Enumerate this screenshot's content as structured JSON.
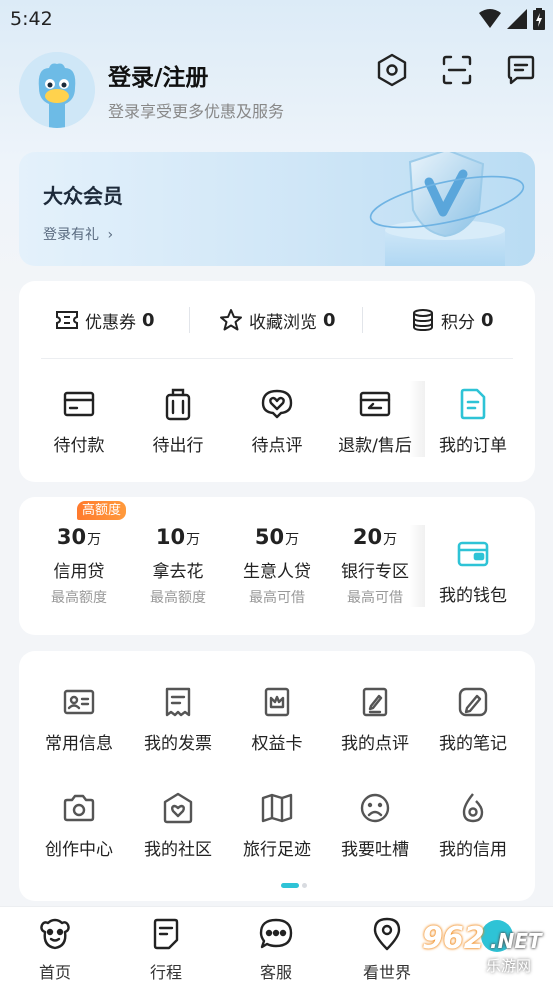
{
  "status_bar": {
    "time": "5:42"
  },
  "header": {
    "title": "登录/注册",
    "subtitle": "登录享受更多优惠及服务",
    "icons": [
      "settings-icon",
      "scan-icon",
      "message-icon"
    ]
  },
  "member_card": {
    "title": "大众会员",
    "link": "登录有礼",
    "chevron": "›"
  },
  "stats": [
    {
      "label": "优惠券",
      "value": "0",
      "icon": "coupon-icon"
    },
    {
      "label": "收藏浏览",
      "value": "0",
      "icon": "star-icon"
    },
    {
      "label": "积分",
      "value": "0",
      "icon": "coins-icon"
    }
  ],
  "orders": [
    {
      "label": "待付款",
      "icon": "card-icon"
    },
    {
      "label": "待出行",
      "icon": "luggage-icon"
    },
    {
      "label": "待点评",
      "icon": "review-heart-icon"
    },
    {
      "label": "退款/售后",
      "icon": "refund-icon"
    },
    {
      "label": "我的订单",
      "icon": "order-doc-icon"
    }
  ],
  "finance": {
    "badge": "高额度",
    "items": [
      {
        "amount": "30",
        "unit": "万",
        "name": "信用贷",
        "sub": "最高额度"
      },
      {
        "amount": "10",
        "unit": "万",
        "name": "拿去花",
        "sub": "最高额度"
      },
      {
        "amount": "50",
        "unit": "万",
        "name": "生意人贷",
        "sub": "最高可借"
      },
      {
        "amount": "20",
        "unit": "万",
        "name": "银行专区",
        "sub": "最高可借"
      }
    ],
    "wallet_label": "我的钱包"
  },
  "tools": [
    {
      "label": "常用信息",
      "icon": "id-card-icon"
    },
    {
      "label": "我的发票",
      "icon": "invoice-icon"
    },
    {
      "label": "权益卡",
      "icon": "crown-card-icon"
    },
    {
      "label": "我的点评",
      "icon": "edit-doc-icon"
    },
    {
      "label": "我的笔记",
      "icon": "note-pencil-icon"
    },
    {
      "label": "创作中心",
      "icon": "camera-icon"
    },
    {
      "label": "我的社区",
      "icon": "community-icon"
    },
    {
      "label": "旅行足迹",
      "icon": "map-icon"
    },
    {
      "label": "我要吐槽",
      "icon": "sad-face-icon"
    },
    {
      "label": "我的信用",
      "icon": "credit-drop-icon"
    }
  ],
  "bottom_nav": [
    {
      "label": "首页",
      "icon": "home-mascot-icon"
    },
    {
      "label": "行程",
      "icon": "itinerary-icon"
    },
    {
      "label": "客服",
      "icon": "chat-icon"
    },
    {
      "label": "看世界",
      "icon": "location-icon"
    }
  ],
  "watermark": {
    "num": "962",
    "net": ".NET",
    "cn": "乐游网"
  },
  "colors": {
    "accent": "#2ec3d6",
    "badge": "#ff7a2e"
  }
}
